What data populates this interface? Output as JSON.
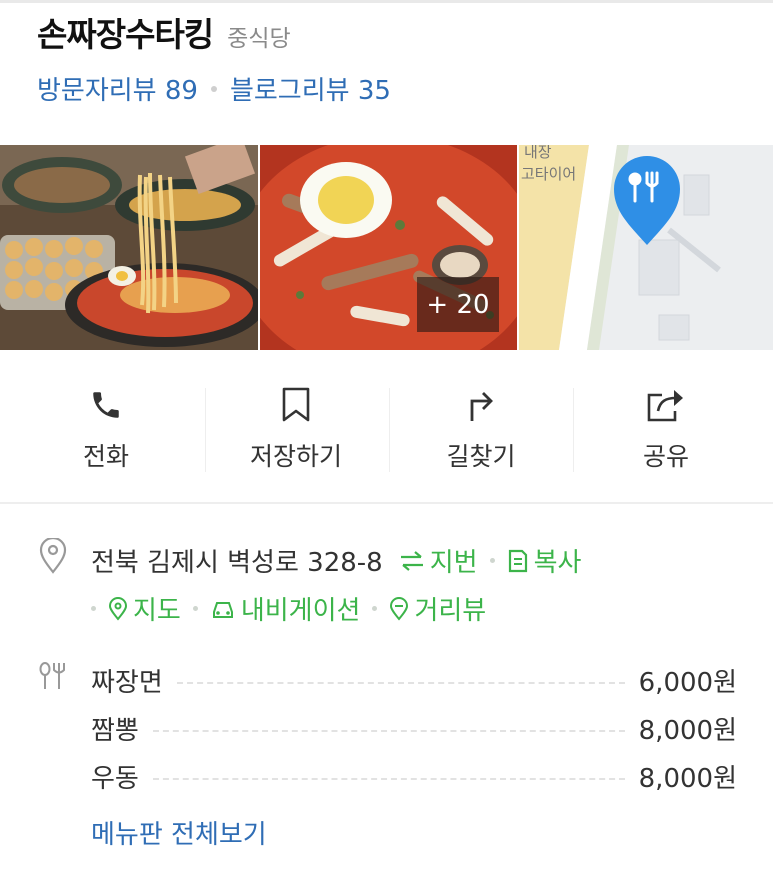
{
  "place": {
    "name": "손짜장수타킹",
    "category": "중식당"
  },
  "reviews": {
    "visitor": "방문자리뷰 89",
    "blog": "블로그리뷰 35"
  },
  "photos": {
    "more_count": "+ 20",
    "map_label": "내장\n고타이어"
  },
  "actions": [
    {
      "label": "전화",
      "icon": "phone-icon"
    },
    {
      "label": "저장하기",
      "icon": "bookmark-icon"
    },
    {
      "label": "길찾기",
      "icon": "directions-icon"
    },
    {
      "label": "공유",
      "icon": "share-icon"
    }
  ],
  "address": {
    "text": "전북 김제시 벽성로 328-8",
    "jibun": "지번",
    "copy": "복사",
    "map": "지도",
    "navigation": "내비게이션",
    "street_view": "거리뷰"
  },
  "menu": {
    "items": [
      {
        "name": "짜장면",
        "price": "6,000원"
      },
      {
        "name": "짬뽕",
        "price": "8,000원"
      },
      {
        "name": "우동",
        "price": "8,000원"
      }
    ],
    "view_all": "메뉴판 전체보기"
  },
  "colors": {
    "link_blue": "#2f6db5",
    "link_green": "#3cb44a",
    "map_pin": "#2f8fe6"
  }
}
